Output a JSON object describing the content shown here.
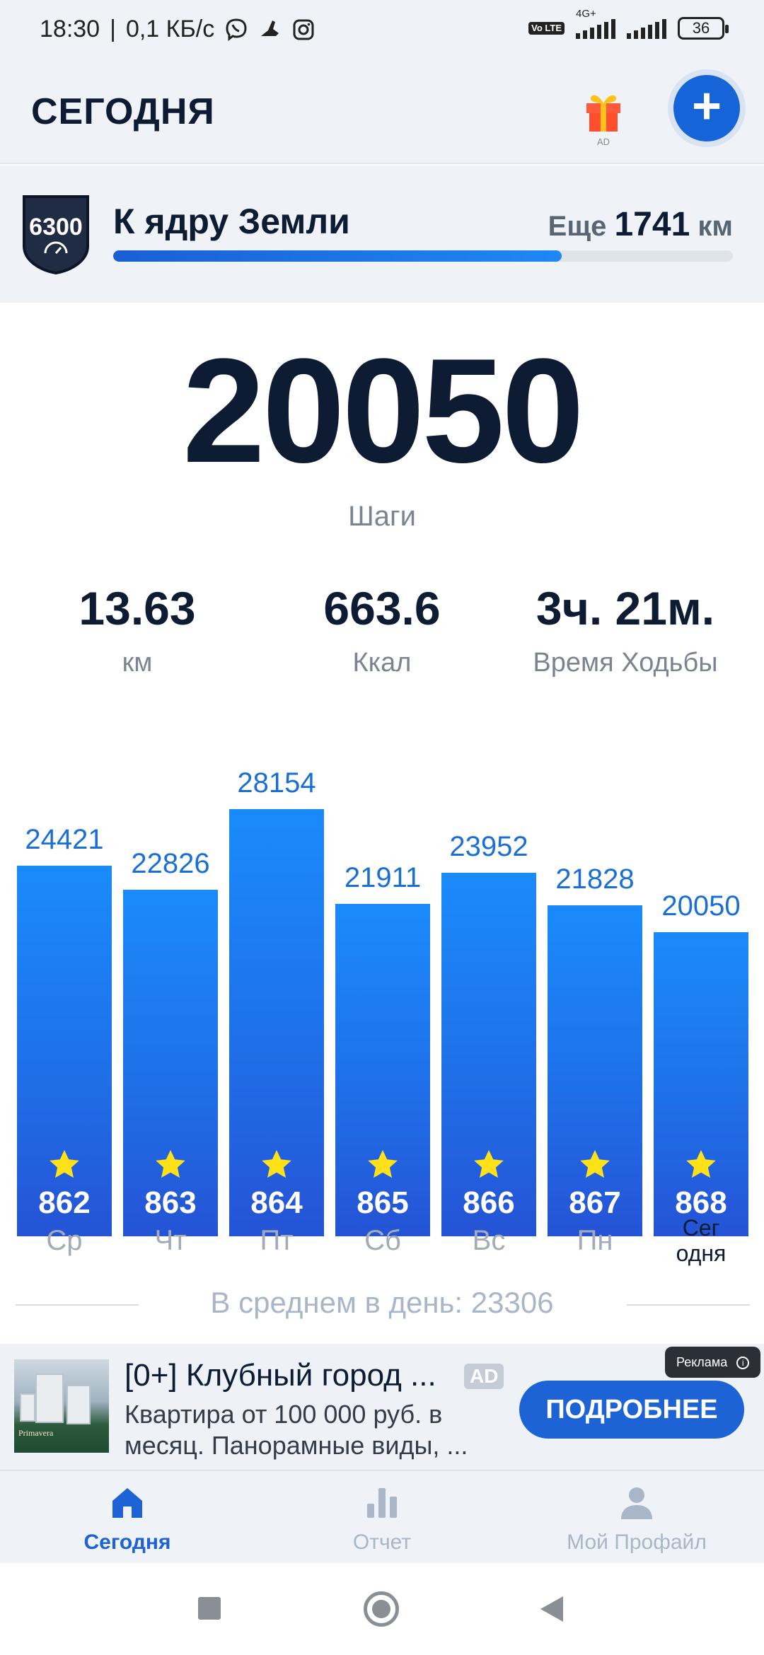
{
  "status": {
    "time": "18:30",
    "speed": "0,1 КБ/с",
    "network": "4G+",
    "volte": "Vo LTE",
    "battery": "36"
  },
  "header": {
    "title": "СЕГОДНЯ",
    "gift_ad": "AD"
  },
  "challenge": {
    "badge": "6300",
    "title": "К ядру Земли",
    "remaining_label": "Еще",
    "remaining_value": "1741",
    "remaining_unit": "км",
    "progress_fraction": 0.724
  },
  "today": {
    "steps": "20050",
    "steps_label": "Шаги",
    "distance": "13.63",
    "distance_unit": "км",
    "calories": "663.6",
    "calories_unit": "Ккал",
    "walk_time": "3ч. 21м.",
    "walk_time_label": "Время Ходьбы"
  },
  "chart_data": {
    "type": "bar",
    "categories": [
      "Ср",
      "Чт",
      "Пт",
      "Сб",
      "Вс",
      "Пн",
      "Сег одня"
    ],
    "values": [
      24421,
      22826,
      28154,
      21911,
      23952,
      21828,
      20050
    ],
    "bar_labels": [
      "862",
      "863",
      "864",
      "865",
      "866",
      "867",
      "868"
    ],
    "ylim": [
      0,
      28154
    ],
    "average_label": "В среднем в день: 23306",
    "accent_color": "#1e63d6"
  },
  "ad": {
    "title": "[0+] Клубный город ...",
    "chip": "AD",
    "text": "Квартира от 100 000 руб. в месяц. Панорамные виды, ...",
    "button": "ПОДРОБНЕЕ",
    "tag": "Реклама",
    "image_brand": "Primavera"
  },
  "nav": {
    "items": [
      {
        "label": "Сегодня",
        "icon": "home-icon"
      },
      {
        "label": "Отчет",
        "icon": "bar-chart-icon"
      },
      {
        "label": "Мой Профайл",
        "icon": "profile-icon"
      }
    ]
  }
}
